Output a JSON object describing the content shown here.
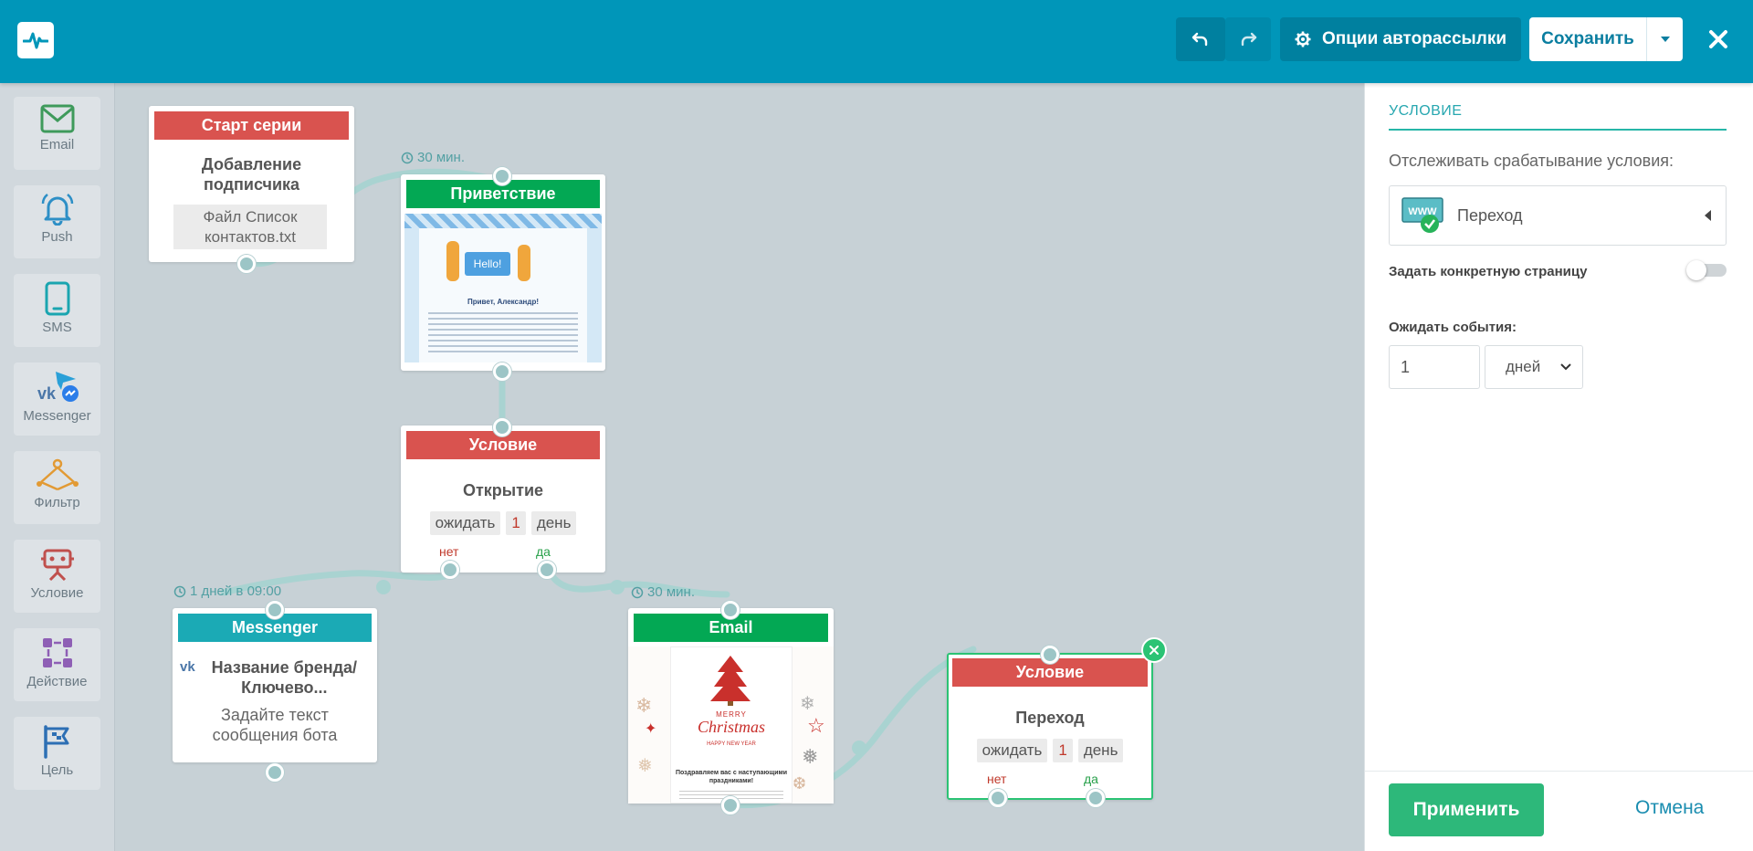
{
  "toolbar": {
    "options_label": "Опции авторассылки",
    "save_label": "Сохранить"
  },
  "sidebar": {
    "items": [
      {
        "label": "Email",
        "icon": "email-icon"
      },
      {
        "label": "Push",
        "icon": "bell-icon"
      },
      {
        "label": "SMS",
        "icon": "phone-icon"
      },
      {
        "label": "Messenger",
        "icon": "messenger-icon"
      },
      {
        "label": "Фильтр",
        "icon": "filter-icon"
      },
      {
        "label": "Условие",
        "icon": "robot-icon"
      },
      {
        "label": "Действие",
        "icon": "action-icon"
      },
      {
        "label": "Цель",
        "icon": "flag-icon"
      }
    ]
  },
  "canvas": {
    "start": {
      "header": "Старт серии",
      "title": "Добавление подписчика",
      "file": "Файл Список контактов.txt"
    },
    "greeting": {
      "delay": "30 мин.",
      "header": "Приветствие",
      "preview": {
        "hello": "Hello!",
        "heading": "Привет, Александр!"
      }
    },
    "cond1": {
      "header": "Условие",
      "title": "Открытие",
      "wait": "ожидать",
      "num": "1",
      "unit": "день",
      "no": "нет",
      "yes": "да"
    },
    "messenger": {
      "delay": "1 дней в 09:00",
      "header": "Messenger",
      "title": "Название бренда/Ключево...",
      "text": "Задайте текст сообщения бота"
    },
    "email": {
      "delay": "30 мин.",
      "header": "Email",
      "preview": {
        "merry": "MERRY",
        "christmas": "Christmas",
        "newyear": "HAPPY NEW YEAR",
        "congrats": "Поздравляем вас с наступающими праздниками!"
      }
    },
    "cond2": {
      "header": "Условие",
      "title": "Переход",
      "wait": "ожидать",
      "num": "1",
      "unit": "день",
      "no": "нет",
      "yes": "да"
    }
  },
  "panel": {
    "title": "УСЛОВИЕ",
    "track_label": "Отслеживать срабатывание условия:",
    "track_value": "Переход",
    "track_icon_text": "WWW",
    "specific_page_label": "Задать конкретную страницу",
    "wait_label": "Ожидать события:",
    "wait_value": "1",
    "wait_unit": "дней",
    "apply_label": "Применить",
    "cancel_label": "Отмена"
  },
  "colors": {
    "topbar": "#0096b9",
    "red_header": "#d9534f",
    "green_header": "#03a854",
    "teal_header": "#1baab5",
    "apply": "#2db87a",
    "accent": "#27b6a8"
  }
}
